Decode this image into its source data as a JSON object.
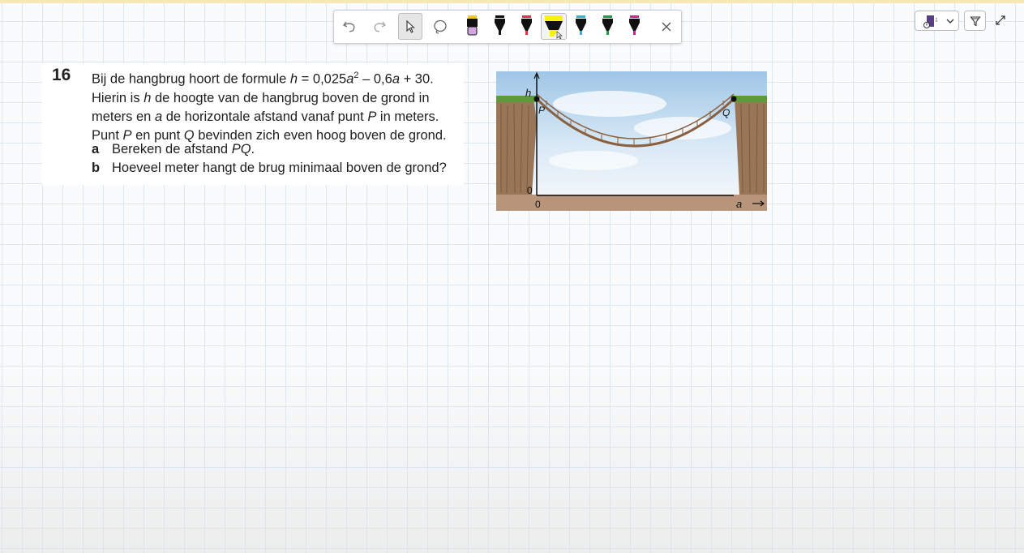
{
  "toolbar": {
    "tools": [
      "undo",
      "redo",
      "select",
      "lasso",
      "pen-purple",
      "pen-black",
      "pen-red",
      "highlighter-yellow",
      "pen-cyan",
      "pen-green",
      "pen-magenta",
      "close"
    ],
    "active_tool": "select",
    "pen_colors": {
      "purple": "#c9a0dc",
      "black": "#111111",
      "red": "#e0304a",
      "yellow": "#f5f212",
      "cyan": "#29b6d8",
      "green": "#1f9a4a",
      "magenta": "#d81b9a"
    }
  },
  "top_right": {
    "icons": [
      "ink-math-icon",
      "chevron-down-icon",
      "filter-icon",
      "expand-icon"
    ]
  },
  "exercise": {
    "number": "16",
    "line1_a": "Bij de hangbrug hoort de formule ",
    "line1_formula_h": "h",
    "line1_formula_mid": " = 0,025",
    "line1_formula_a": "a",
    "line1_formula_sup": "2",
    "line1_formula_rest": " – 0,6",
    "line1_formula_a2": "a",
    "line1_formula_end": " + 30.",
    "line2_a": "Hierin is ",
    "line2_h": "h",
    "line2_b": " de hoogte van de hangbrug boven de grond in",
    "line3_a": "meters en ",
    "line3_var": "a",
    "line3_b": " de horizontale afstand vanaf punt ",
    "line3_p": "P",
    "line3_c": " in meters.",
    "line4_a": "Punt ",
    "line4_p": "P",
    "line4_b": " en punt ",
    "line4_q": "Q",
    "line4_c": " bevinden zich even hoog boven de grond.",
    "qa_label": "a",
    "qa_text": "Bereken de afstand ",
    "qa_pq": "PQ",
    "qa_end": ".",
    "qb_label": "b",
    "qb_text": "Hoeveel meter hangt de brug minimaal boven de grond?"
  },
  "figure": {
    "h_label": "h",
    "a_label": "a",
    "zero_y": "0",
    "zero_x": "0",
    "p_label": "P",
    "q_label": "Q",
    "sky_color": "#bcd8ee",
    "ground_color": "#b8957a",
    "cliff_color": "#9a7658",
    "grass_color": "#5f9a3a",
    "rope_color": "#8a6040"
  }
}
